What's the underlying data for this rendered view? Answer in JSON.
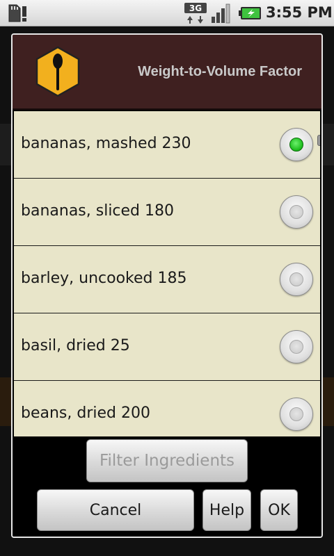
{
  "status_bar": {
    "time": "3:55 PM",
    "icons": [
      "sd-card-icon",
      "warning-icon",
      "3g-data-icon",
      "signal-icon",
      "battery-charging-icon"
    ],
    "network_label": "3G"
  },
  "dialog": {
    "title": "Weight-to-Volume Factor",
    "icon": "spoon-hexagon-icon",
    "colors": {
      "header": "#3f2020",
      "list_bg": "#e8e5c9",
      "selected": "#1fbe1f"
    },
    "items": [
      {
        "label": "bananas, mashed 230",
        "selected": true
      },
      {
        "label": "bananas, sliced 180",
        "selected": false
      },
      {
        "label": "barley, uncooked 185",
        "selected": false
      },
      {
        "label": "basil, dried 25",
        "selected": false
      },
      {
        "label": "beans, dried 200",
        "selected": false
      }
    ],
    "filter_button": "Filter Ingredients",
    "buttons": {
      "cancel": "Cancel",
      "help": "Help",
      "ok": "OK"
    }
  }
}
